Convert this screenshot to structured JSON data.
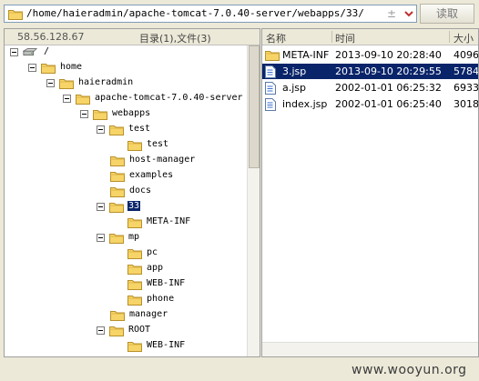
{
  "address_bar": {
    "path": "/home/haieradmin/apache-tomcat-7.0.40-server/webapps/33/",
    "plus_glyph": "±",
    "read_button": "读取"
  },
  "tree_panel": {
    "ip": "58.56.128.67",
    "summary": "目录(1),文件(3)",
    "nodes": [
      {
        "label": "/"
      },
      {
        "label": "home"
      },
      {
        "label": "haieradmin"
      },
      {
        "label": "apache-tomcat-7.0.40-server"
      },
      {
        "label": "webapps"
      },
      {
        "label": "test"
      },
      {
        "label": "test"
      },
      {
        "label": "host-manager"
      },
      {
        "label": "examples"
      },
      {
        "label": "docs"
      },
      {
        "label": "33"
      },
      {
        "label": "META-INF"
      },
      {
        "label": "mp"
      },
      {
        "label": "pc"
      },
      {
        "label": "app"
      },
      {
        "label": "WEB-INF"
      },
      {
        "label": "phone"
      },
      {
        "label": "manager"
      },
      {
        "label": "ROOT"
      },
      {
        "label": "WEB-INF"
      }
    ]
  },
  "file_panel": {
    "columns": {
      "name": "名称",
      "time": "时间",
      "size": "大小"
    },
    "rows": [
      {
        "name": "META-INF",
        "time": "2013-09-10 20:28:40",
        "size": "4096",
        "icon": "folder-icon"
      },
      {
        "name": "3.jsp",
        "time": "2013-09-10 20:29:55",
        "size": "5784",
        "icon": "file-icon",
        "selected": true
      },
      {
        "name": "a.jsp",
        "time": "2002-01-01 06:25:32",
        "size": "6933",
        "icon": "file-icon"
      },
      {
        "name": "index.jsp",
        "time": "2002-01-01 06:25:40",
        "size": "3018",
        "icon": "file-icon"
      }
    ]
  },
  "watermark": "www.wooyun.org",
  "colors": {
    "selection": "#0a246a",
    "folder": "#f6d468",
    "background": "#ece9d8"
  }
}
